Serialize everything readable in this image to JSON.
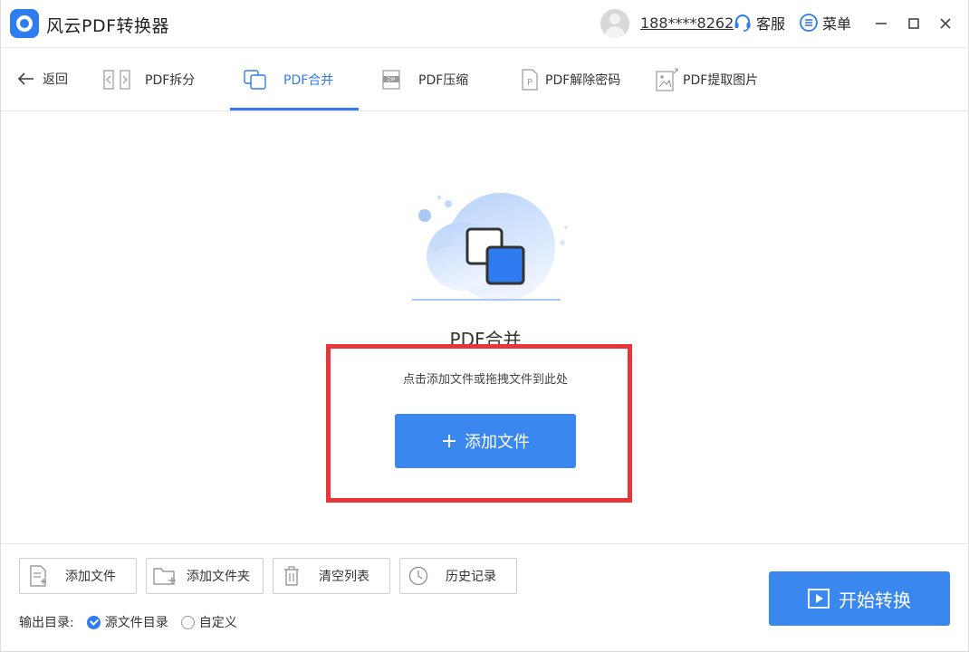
{
  "app": {
    "title": "风云PDF转换器"
  },
  "header": {
    "user_phone": "188****8262",
    "service_label": "客服",
    "menu_label": "菜单"
  },
  "nav": {
    "back_label": "返回",
    "tabs": [
      {
        "label": "PDF拆分",
        "icon": "split-icon"
      },
      {
        "label": "PDF合并",
        "icon": "merge-icon",
        "active": true
      },
      {
        "label": "PDF压缩",
        "icon": "zip-icon"
      },
      {
        "label": "PDF解除密码",
        "icon": "unlock-icon"
      },
      {
        "label": "PDF提取图片",
        "icon": "image-icon"
      }
    ]
  },
  "main": {
    "title": "PDF合并",
    "hint": "点击添加文件或拖拽文件到此处",
    "add_button_label": "添加文件"
  },
  "toolbar": {
    "add_file_label": "添加文件",
    "add_folder_label": "添加文件夹",
    "clear_list_label": "清空列表",
    "history_label": "历史记录",
    "output_label": "输出目录:",
    "output_options": [
      {
        "label": "源文件目录",
        "checked": true
      },
      {
        "label": "自定义",
        "checked": false
      }
    ],
    "start_label": "开始转换"
  },
  "colors": {
    "accent": "#3a87ef",
    "highlight": "#e9343a"
  }
}
